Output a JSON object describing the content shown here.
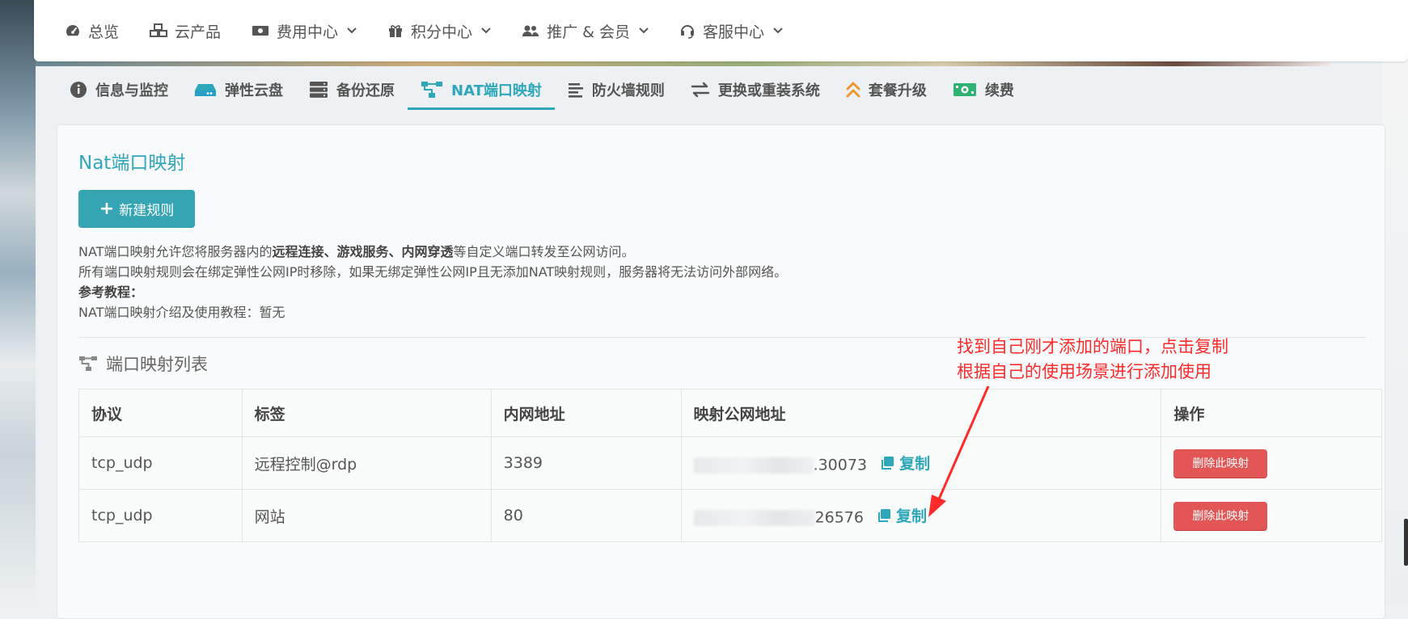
{
  "topnav": {
    "items": [
      {
        "label": "总览",
        "icon": "speedometer-icon",
        "has_dropdown": false
      },
      {
        "label": "云产品",
        "icon": "cubes-icon",
        "has_dropdown": false
      },
      {
        "label": "费用中心",
        "icon": "money-bill-icon",
        "has_dropdown": true
      },
      {
        "label": "积分中心",
        "icon": "gift-icon",
        "has_dropdown": true
      },
      {
        "label": "推广 & 会员",
        "icon": "users-icon",
        "has_dropdown": true
      },
      {
        "label": "客服中心",
        "icon": "headset-icon",
        "has_dropdown": true
      }
    ]
  },
  "subtabs": [
    {
      "label": "信息与监控",
      "icon": "info-circle-icon",
      "active": false
    },
    {
      "label": "弹性云盘",
      "icon": "hard-drive-icon",
      "active": false
    },
    {
      "label": "备份还原",
      "icon": "server-icon",
      "active": false
    },
    {
      "label": "NAT端口映射",
      "icon": "network-icon",
      "active": true
    },
    {
      "label": "防火墙规则",
      "icon": "align-left-icon",
      "active": false
    },
    {
      "label": "更换或重装系统",
      "icon": "exchange-icon",
      "active": false
    },
    {
      "label": "套餐升级",
      "icon": "double-up-icon",
      "active": false
    },
    {
      "label": "续费",
      "icon": "money-icon",
      "active": false
    }
  ],
  "panel": {
    "title": "Nat端口映射",
    "new_button": "新建规则",
    "desc": {
      "line1_pre": "NAT端口映射允许您将服务器内的",
      "line1_bold": "远程连接、游戏服务、内网穿透",
      "line1_post": "等自定义端口转发至公网访问。",
      "line2": "所有端口映射规则会在绑定弹性公网IP时移除，如果无绑定弹性公网IP且无添加NAT映射规则，服务器将无法访问外部网络。",
      "line3": "参考教程：",
      "line4": "NAT端口映射介绍及使用教程：暂无"
    },
    "list_title": "端口映射列表"
  },
  "table": {
    "headers": [
      "协议",
      "标签",
      "内网地址",
      "映射公网地址",
      "操作"
    ],
    "rows": [
      {
        "protocol": "tcp_udp",
        "tag": "远程控制@rdp",
        "internal": "3389",
        "public_suffix": ".30073",
        "copy": "复制",
        "action": "删除此映射"
      },
      {
        "protocol": "tcp_udp",
        "tag": "网站",
        "internal": "80",
        "public_suffix": "26576",
        "copy": "复制",
        "action": "删除此映射"
      }
    ]
  },
  "annotation": {
    "line1": "找到自己刚才添加的端口，点击复制",
    "line2": "根据自己的使用场景进行添加使用"
  },
  "colors": {
    "accent": "#2fa7ba",
    "button": "#35a4b3",
    "danger": "#e35656",
    "annotation": "#ff2a2a"
  }
}
